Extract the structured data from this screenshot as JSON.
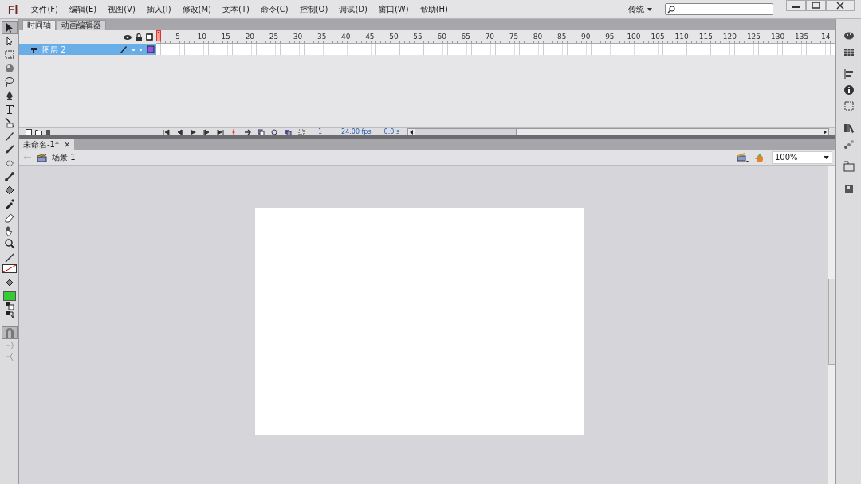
{
  "app": {
    "logo": "Fl",
    "menus": [
      "文件(F)",
      "编辑(E)",
      "视图(V)",
      "插入(I)",
      "修改(M)",
      "文本(T)",
      "命令(C)",
      "控制(O)",
      "调试(D)",
      "窗口(W)",
      "帮助(H)"
    ],
    "workspace": "传统"
  },
  "timeline": {
    "tabs": [
      {
        "label": "时间轴",
        "selected": true
      },
      {
        "label": "动画编辑器",
        "selected": false
      }
    ],
    "playhead": "1",
    "frame_numbers": [
      "5",
      "10",
      "15",
      "20",
      "25",
      "30",
      "35",
      "40",
      "45",
      "50",
      "55",
      "60",
      "65",
      "70",
      "75",
      "80",
      "85",
      "90",
      "95",
      "100",
      "105",
      "110",
      "115",
      "120",
      "125",
      "130",
      "135",
      "14"
    ],
    "layers": [
      {
        "name": "图层 2",
        "selected": true
      }
    ],
    "current_frame": "1",
    "frame_rate": "24.00 fps",
    "elapsed_time": "0.0 s"
  },
  "document": {
    "tab": "未命名-1*",
    "close": "×",
    "scene": "场景 1",
    "zoom": "100%"
  },
  "tools": [
    {
      "selected": true
    },
    {
      "selected": false
    },
    {
      "selected": false
    },
    {
      "selected": false
    },
    {
      "selected": false
    },
    {
      "selected": false
    },
    {
      "selected": false
    },
    {
      "selected": false
    },
    {
      "selected": false
    },
    {
      "selected": false
    },
    {
      "selected": false
    },
    {
      "selected": false
    },
    {
      "selected": false
    },
    {
      "selected": false
    },
    {
      "selected": false
    },
    {
      "selected": false
    },
    {
      "selected": false
    },
    {
      "selected": false
    }
  ],
  "snap": {
    "on": true
  }
}
